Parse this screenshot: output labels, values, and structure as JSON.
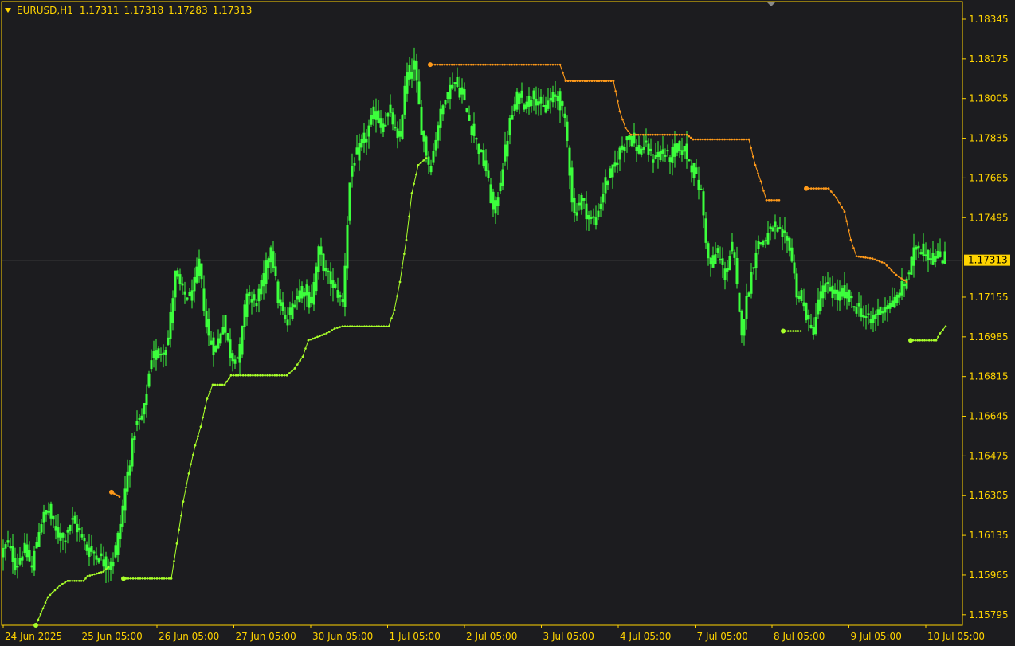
{
  "header": {
    "symbol_timeframe": "EURUSD,H1",
    "ohlc": [
      "1.17311",
      "1.17318",
      "1.17283",
      "1.17313"
    ]
  },
  "colors": {
    "background": "#1c1c1f",
    "frame": "#ffd400",
    "axis_text": "#ffd400",
    "candle": "#3cff3c",
    "trail_up": "#a8ff2a",
    "trail_down": "#ff9a1a",
    "price_line": "#8a8a8a",
    "price_badge": "#ffd400",
    "price_badge_text": "#000000"
  },
  "chart_data": {
    "type": "candlestick",
    "symbol": "EURUSD",
    "timeframe": "H1",
    "y_ticks": [
      "1.18345",
      "1.18175",
      "1.18005",
      "1.17835",
      "1.17665",
      "1.17495",
      "1.17313",
      "1.17155",
      "1.16985",
      "1.16815",
      "1.16645",
      "1.16475",
      "1.16305",
      "1.16135",
      "1.15965",
      "1.15795"
    ],
    "ylim": [
      1.1575,
      1.1842
    ],
    "x_ticks": [
      "24 Jun 2025",
      "25 Jun 05:00",
      "26 Jun 05:00",
      "27 Jun 05:00",
      "30 Jun 05:00",
      "1 Jul 05:00",
      "2 Jul 05:00",
      "3 Jul 05:00",
      "4 Jul 05:00",
      "7 Jul 05:00",
      "8 Jul 05:00",
      "9 Jul 05:00",
      "10 Jul 05:00"
    ],
    "current_price": "1.17313",
    "close_series": [
      [
        0,
        1.1605
      ],
      [
        10,
        1.161
      ],
      [
        20,
        1.16
      ],
      [
        30,
        1.1608
      ],
      [
        40,
        1.16
      ],
      [
        50,
        1.1618
      ],
      [
        60,
        1.1625
      ],
      [
        70,
        1.1615
      ],
      [
        80,
        1.1612
      ],
      [
        90,
        1.162
      ],
      [
        100,
        1.1615
      ],
      [
        110,
        1.1607
      ],
      [
        120,
        1.1606
      ],
      [
        130,
        1.1602
      ],
      [
        140,
        1.16
      ],
      [
        150,
        1.1616
      ],
      [
        160,
        1.164
      ],
      [
        170,
        1.166
      ],
      [
        180,
        1.1665
      ],
      [
        190,
        1.169
      ],
      [
        200,
        1.1692
      ],
      [
        210,
        1.1695
      ],
      [
        220,
        1.1725
      ],
      [
        230,
        1.1717
      ],
      [
        240,
        1.1715
      ],
      [
        250,
        1.173
      ],
      [
        260,
        1.17
      ],
      [
        270,
        1.1692
      ],
      [
        280,
        1.1705
      ],
      [
        290,
        1.169
      ],
      [
        300,
        1.169
      ],
      [
        310,
        1.1718
      ],
      [
        320,
        1.1712
      ],
      [
        330,
        1.1722
      ],
      [
        340,
        1.1738
      ],
      [
        350,
        1.1712
      ],
      [
        360,
        1.1705
      ],
      [
        370,
        1.1715
      ],
      [
        380,
        1.172
      ],
      [
        390,
        1.1712
      ],
      [
        400,
        1.1735
      ],
      [
        410,
        1.1725
      ],
      [
        420,
        1.172
      ],
      [
        430,
        1.1713
      ],
      [
        440,
        1.177
      ],
      [
        450,
        1.1778
      ],
      [
        460,
        1.1785
      ],
      [
        470,
        1.1795
      ],
      [
        480,
        1.1788
      ],
      [
        490,
        1.1795
      ],
      [
        500,
        1.178
      ],
      [
        510,
        1.181
      ],
      [
        520,
        1.1815
      ],
      [
        530,
        1.1785
      ],
      [
        540,
        1.177
      ],
      [
        550,
        1.179
      ],
      [
        560,
        1.1802
      ],
      [
        570,
        1.1808
      ],
      [
        580,
        1.1802
      ],
      [
        590,
        1.179
      ],
      [
        600,
        1.178
      ],
      [
        610,
        1.177
      ],
      [
        620,
        1.175
      ],
      [
        630,
        1.177
      ],
      [
        640,
        1.179
      ],
      [
        650,
        1.1802
      ],
      [
        660,
        1.1798
      ],
      [
        670,
        1.1803
      ],
      [
        680,
        1.1795
      ],
      [
        690,
        1.18
      ],
      [
        700,
        1.1802
      ],
      [
        710,
        1.179
      ],
      [
        720,
        1.175
      ],
      [
        730,
        1.1758
      ],
      [
        740,
        1.1748
      ],
      [
        750,
        1.175
      ],
      [
        760,
        1.1765
      ],
      [
        770,
        1.177
      ],
      [
        780,
        1.178
      ],
      [
        790,
        1.1785
      ],
      [
        800,
        1.1778
      ],
      [
        810,
        1.178
      ],
      [
        820,
        1.1775
      ],
      [
        830,
        1.1778
      ],
      [
        840,
        1.1775
      ],
      [
        850,
        1.178
      ],
      [
        860,
        1.1778
      ],
      [
        870,
        1.177
      ],
      [
        880,
        1.176
      ],
      [
        890,
        1.1728
      ],
      [
        900,
        1.1735
      ],
      [
        910,
        1.1725
      ],
      [
        920,
        1.1738
      ],
      [
        930,
        1.17
      ],
      [
        940,
        1.172
      ],
      [
        950,
        1.1738
      ],
      [
        960,
        1.174
      ],
      [
        970,
        1.1745
      ],
      [
        980,
        1.1742
      ],
      [
        990,
        1.174
      ],
      [
        1000,
        1.1718
      ],
      [
        1010,
        1.171
      ],
      [
        1020,
        1.17
      ],
      [
        1030,
        1.1718
      ],
      [
        1040,
        1.172
      ],
      [
        1050,
        1.1715
      ],
      [
        1060,
        1.1718
      ],
      [
        1070,
        1.1712
      ],
      [
        1080,
        1.171
      ],
      [
        1090,
        1.1705
      ],
      [
        1100,
        1.1708
      ],
      [
        1110,
        1.1712
      ],
      [
        1120,
        1.1712
      ],
      [
        1130,
        1.1718
      ],
      [
        1140,
        1.1725
      ],
      [
        1150,
        1.1738
      ],
      [
        1160,
        1.1735
      ],
      [
        1170,
        1.1732
      ],
      [
        1180,
        1.1733
      ],
      [
        1186,
        1.17313
      ]
    ],
    "trail_up": [
      [
        [
          45,
          1.1575
        ],
        [
          60,
          1.1587
        ],
        [
          75,
          1.1592
        ],
        [
          85,
          1.1594
        ],
        [
          105,
          1.1594
        ],
        [
          110,
          1.1596
        ],
        [
          130,
          1.1598
        ],
        [
          136,
          1.16
        ]
      ],
      [
        [
          155,
          1.1595
        ],
        [
          215,
          1.1595
        ],
        [
          222,
          1.161
        ],
        [
          230,
          1.1628
        ],
        [
          237,
          1.164
        ],
        [
          245,
          1.1652
        ],
        [
          252,
          1.166
        ],
        [
          260,
          1.1672
        ],
        [
          267,
          1.1678
        ],
        [
          282,
          1.1678
        ],
        [
          290,
          1.1682
        ],
        [
          360,
          1.1682
        ],
        [
          370,
          1.1685
        ],
        [
          380,
          1.169
        ],
        [
          387,
          1.1697
        ],
        [
          410,
          1.17
        ],
        [
          420,
          1.1702
        ],
        [
          430,
          1.1703
        ],
        [
          488,
          1.1703
        ],
        [
          495,
          1.171
        ],
        [
          502,
          1.1722
        ],
        [
          510,
          1.174
        ],
        [
          517,
          1.176
        ],
        [
          525,
          1.1772
        ],
        [
          535,
          1.1775
        ]
      ],
      [
        [
          983,
          1.1701
        ],
        [
          1005,
          1.1701
        ]
      ],
      [
        [
          1143,
          1.1697
        ],
        [
          1175,
          1.1697
        ],
        [
          1180,
          1.17
        ],
        [
          1187,
          1.1703
        ]
      ]
    ],
    "trail_down": [
      [
        [
          140,
          1.1632
        ],
        [
          150,
          1.163
        ]
      ],
      [
        [
          540,
          1.1815
        ],
        [
          703,
          1.1815
        ],
        [
          710,
          1.1808
        ],
        [
          770,
          1.1808
        ],
        [
          778,
          1.1795
        ],
        [
          785,
          1.1788
        ],
        [
          792,
          1.1785
        ],
        [
          862,
          1.1785
        ],
        [
          870,
          1.1783
        ],
        [
          940,
          1.1783
        ],
        [
          948,
          1.1772
        ],
        [
          955,
          1.1765
        ],
        [
          962,
          1.1757
        ],
        [
          978,
          1.1757
        ]
      ],
      [
        [
          1012,
          1.1762
        ],
        [
          1040,
          1.1762
        ],
        [
          1050,
          1.1758
        ],
        [
          1060,
          1.1752
        ],
        [
          1068,
          1.174
        ],
        [
          1075,
          1.1733
        ],
        [
          1095,
          1.1732
        ],
        [
          1110,
          1.173
        ],
        [
          1125,
          1.1725
        ],
        [
          1138,
          1.1722
        ]
      ]
    ]
  }
}
